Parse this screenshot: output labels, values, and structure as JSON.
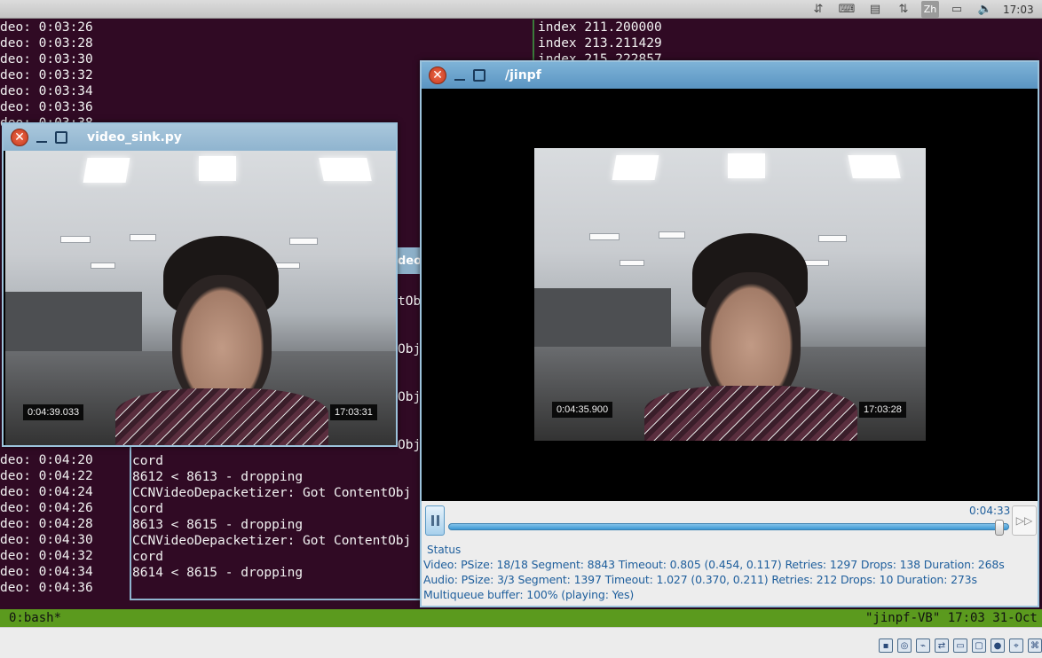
{
  "top_panel": {
    "clock": "17:03",
    "tray_icons": [
      "network-icon",
      "keyboard-icon",
      "document-icon",
      "transfer-icon",
      "language-icon",
      "battery-icon",
      "volume-icon"
    ],
    "lang_label": "Zh"
  },
  "terminal": {
    "left_lines_top": [
      "deo: 0:03:26",
      "deo: 0:03:28",
      "deo: 0:03:30",
      "deo: 0:03:32",
      "deo: 0:03:34",
      "deo: 0:03:36",
      "deo: 0:03:38"
    ],
    "left_lines_bottom": [
      "deo: 0:04:20",
      "deo: 0:04:22",
      "deo: 0:04:24",
      "deo: 0:04:26",
      "deo: 0:04:28",
      "deo: 0:04:30",
      "deo: 0:04:32",
      "deo: 0:04:34",
      "deo: 0:04:36"
    ],
    "right_lines": [
      "index 211.200000",
      "index 213.211429",
      "index 215.222857"
    ]
  },
  "pane2": {
    "title_fragment": "deo/",
    "side_fragments": [
      "tObj",
      "Obj",
      "Obj",
      "Obj"
    ],
    "lines": [
      "cord",
      "8612 < 8613 - dropping",
      "CCNVideoDepacketizer: Got ContentObj",
      "cord",
      "8613 < 8615 - dropping",
      "CCNVideoDepacketizer: Got ContentObj",
      "cord",
      "8614 < 8615 - dropping"
    ]
  },
  "tmux": {
    "left": "0:bash*",
    "right": "\"jinpf-VB\" 17:03 31-Oct"
  },
  "video_sink": {
    "title": "video_sink.py",
    "timestamp_left": "0:04:39.033",
    "timestamp_right": "17:03:31"
  },
  "player": {
    "title": "/jinpf",
    "timestamp_left": "0:04:35.900",
    "timestamp_right": "17:03:28",
    "time": "0:04:33",
    "progress": 0.99,
    "status_header": "Status",
    "video_status": "Video: PSize: 18/18 Segment: 8843 Timeout: 0.805 (0.454, 0.117) Retries: 1297 Drops: 138 Duration: 268s",
    "audio_status": "Audio: PSize: 3/3 Segment: 1397 Timeout: 1.027 (0.370, 0.211) Retries: 212 Drops: 10 Duration: 273s",
    "buffer_status": "Multiqueue buffer: 100% (playing: Yes)"
  },
  "vbox_bar": {
    "icons": [
      "hdd-icon",
      "cd-icon",
      "usb-icon",
      "network-icon",
      "shared-folder-icon",
      "display-icon",
      "video-capture-icon",
      "mouse-integration-icon",
      "host-key-icon"
    ]
  }
}
